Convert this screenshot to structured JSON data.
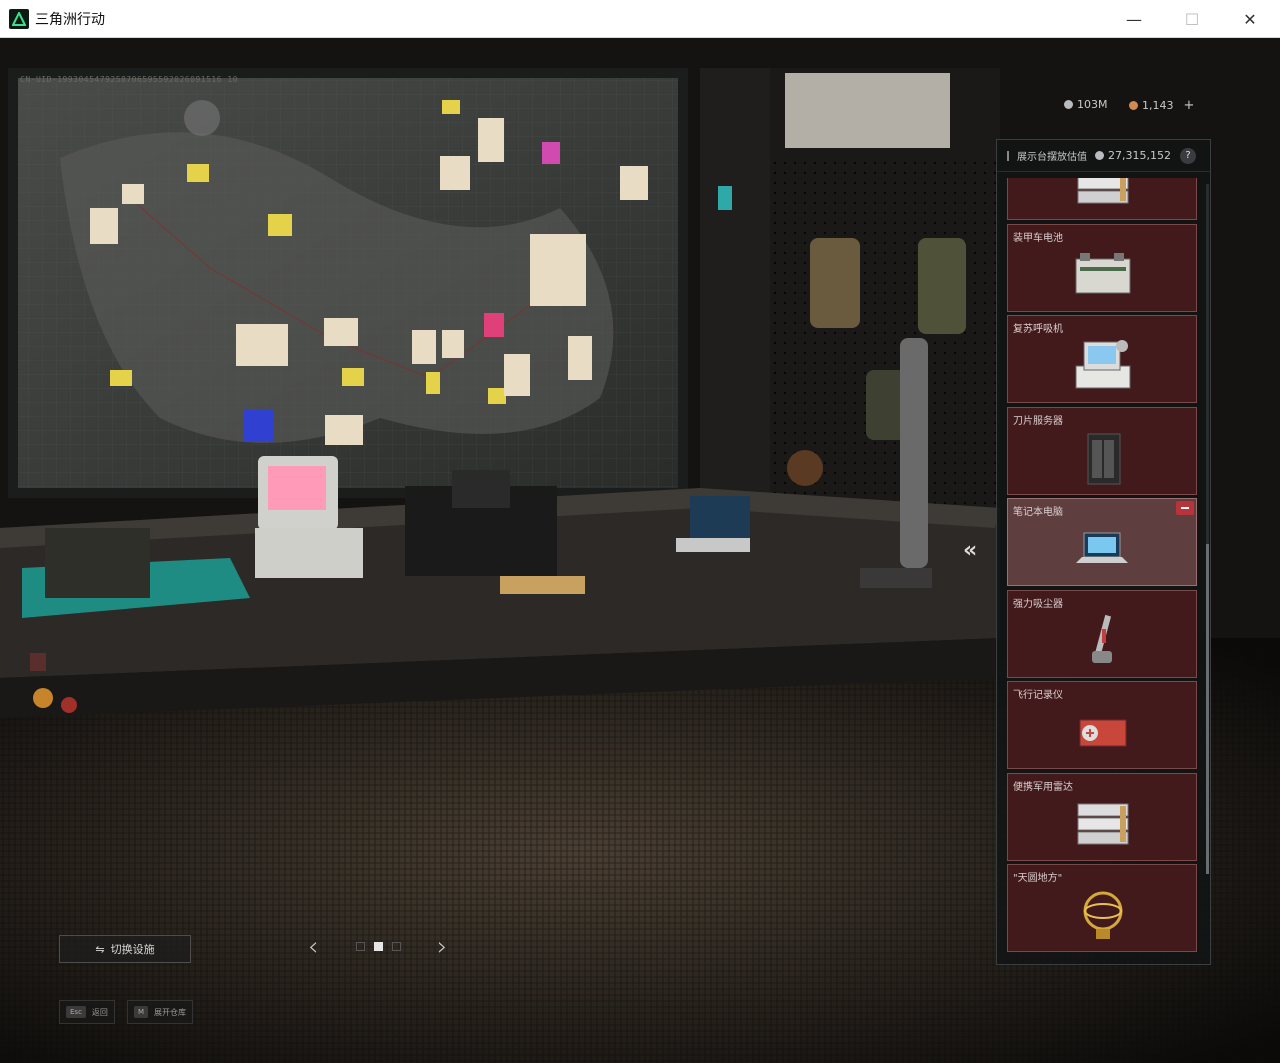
{
  "window": {
    "title": "三角洲行动",
    "controls": {
      "minimize": "—",
      "maximize": "☐",
      "close": "✕"
    }
  },
  "scene": {
    "uid": "CN·UID·1993045479258706595592026091516 10"
  },
  "currency": {
    "silver": {
      "value": "103M",
      "icon": "silver-coin-icon",
      "color": "#b9bcbf"
    },
    "gold": {
      "value": "1,143",
      "icon": "gold-coin-icon",
      "color": "#d08a52"
    },
    "add_label": "+"
  },
  "panel": {
    "title": "展示台摆放估值",
    "value": "27,315,152",
    "help": "?",
    "items": [
      {
        "name": "",
        "art": "server-rack",
        "selected": false
      },
      {
        "name": "装甲车电池",
        "art": "battery",
        "selected": false
      },
      {
        "name": "复苏呼吸机",
        "art": "ventilator",
        "selected": false
      },
      {
        "name": "刀片服务器",
        "art": "blade-server",
        "selected": false
      },
      {
        "name": "笔记本电脑",
        "art": "laptop",
        "selected": true
      },
      {
        "name": "强力吸尘器",
        "art": "vacuum",
        "selected": false
      },
      {
        "name": "飞行记录仪",
        "art": "flight-recorder",
        "selected": false
      },
      {
        "name": "便携军用雷达",
        "art": "server-rack",
        "selected": false
      },
      {
        "name": "\"天圆地方\"",
        "art": "armillary",
        "selected": false
      }
    ]
  },
  "collapse_label": "«",
  "switch_facility": {
    "label": "切换设施",
    "icon": "swap-icon"
  },
  "pager": {
    "prev": "‹",
    "next": "›",
    "pages": 3,
    "current": 1
  },
  "hints": [
    {
      "key": "Esc",
      "label": "返回"
    },
    {
      "key": "M",
      "label": "展开仓库"
    }
  ]
}
